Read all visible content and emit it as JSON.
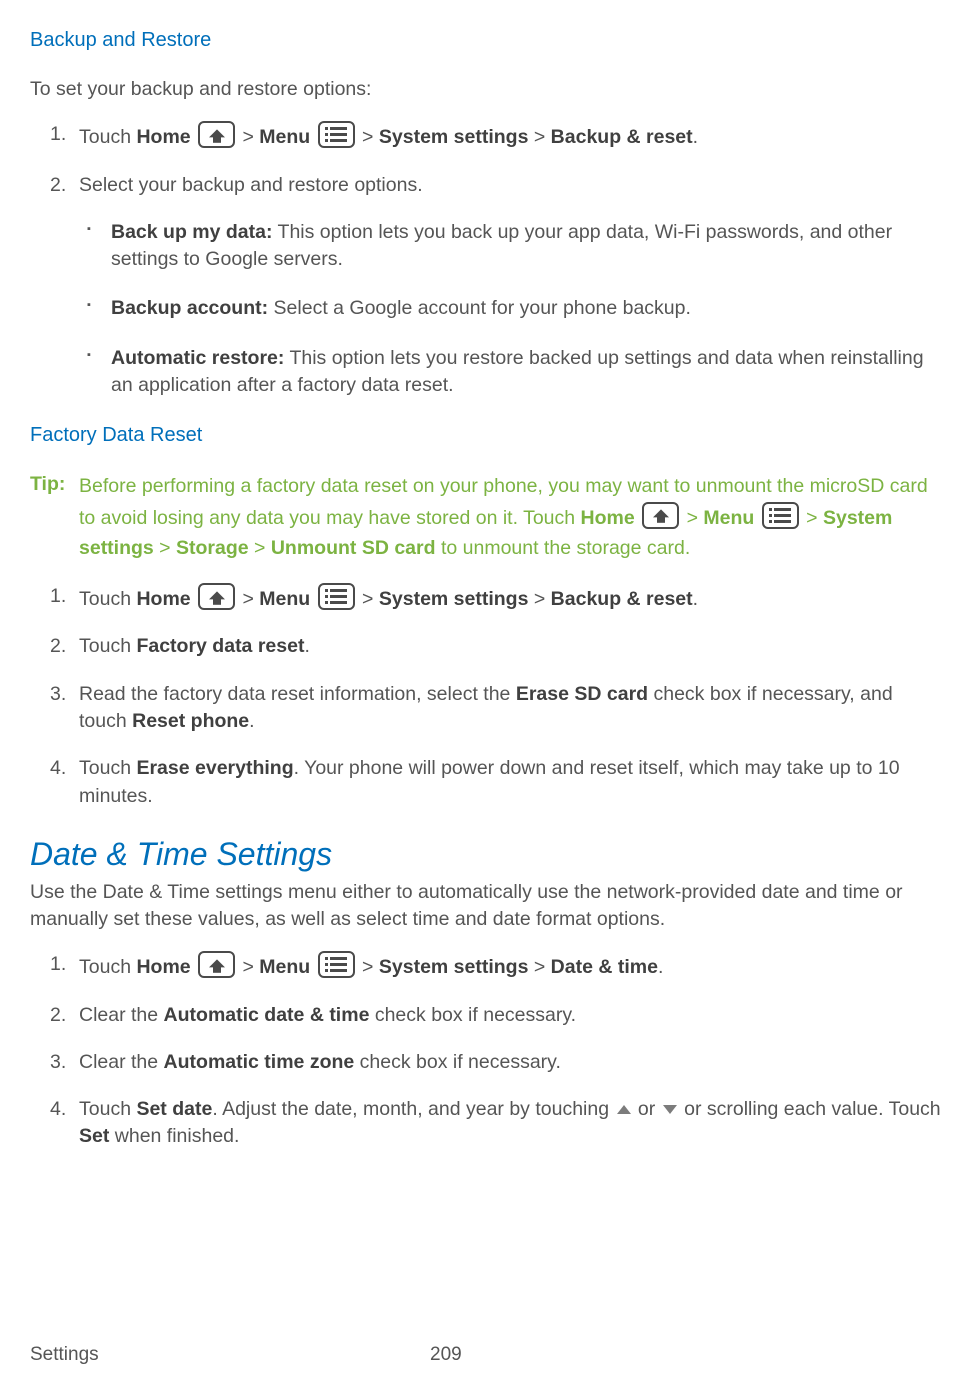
{
  "section1": {
    "title": "Backup and Restore",
    "intro": "To set your backup and restore options:",
    "step1_touch": "Touch ",
    "home_label": "Home",
    "gt": " > ",
    "menu_label": "Menu",
    "system_settings_label": "System settings",
    "backup_reset_label": "Backup & reset",
    "step1_end": ".",
    "step2": "Select your backup and restore options.",
    "bullet1_bold": "Back up my data:",
    "bullet1_text": " This option lets you back up your app data, Wi-Fi passwords, and other settings to Google servers.",
    "bullet2_bold": "Backup account:",
    "bullet2_text": " Select a Google account for your phone backup.",
    "bullet3_bold": "Automatic restore:",
    "bullet3_text": " This option lets you restore backed up settings and data when reinstalling an application after a factory data reset."
  },
  "section2": {
    "title": "Factory Data Reset",
    "tip_label": "Tip:",
    "tip_text1": "Before performing a factory data reset on your phone, you may want to unmount the microSD card to avoid losing any data you may have stored on it. Touch ",
    "home_label": "Home",
    "gt": " > ",
    "menu_label": "Menu",
    "system_settings_label": "System settings",
    "storage_label": "Storage",
    "unmount_label": "Unmount SD card",
    "tip_text2": " to unmount the storage card.",
    "step1_touch": "Touch ",
    "backup_reset_label": "Backup & reset",
    "step1_end": ".",
    "step2_pre": "Touch ",
    "step2_bold": "Factory data reset",
    "step2_post": ".",
    "step3_pre": "Read the factory data reset information, select the ",
    "step3_bold1": "Erase SD card",
    "step3_mid": " check box if necessary, and touch ",
    "step3_bold2": "Reset phone",
    "step3_post": ".",
    "step4_pre": "Touch ",
    "step4_bold": "Erase everything",
    "step4_post": ". Your phone will power down and reset itself, which may take up to 10 minutes."
  },
  "section3": {
    "title": "Date & Time Settings",
    "intro": "Use the Date & Time settings menu either to automatically use the network-provided date and time or manually set these values, as well as select time and date format options.",
    "step1_touch": "Touch ",
    "home_label": "Home",
    "gt": " > ",
    "menu_label": "Menu",
    "system_settings_label": "System settings",
    "date_time_label": "Date & time",
    "step1_end": ".",
    "step2_pre": "Clear the ",
    "step2_bold": "Automatic date & time",
    "step2_post": " check box if necessary.",
    "step3_pre": "Clear the ",
    "step3_bold": "Automatic time zone",
    "step3_post": " check box if necessary.",
    "step4_pre": "Touch ",
    "step4_bold1": "Set date",
    "step4_mid1": ". Adjust the date, month, and year by touching ",
    "step4_or": " or ",
    "step4_mid2": " or scrolling each value. Touch ",
    "step4_bold2": "Set",
    "step4_post": " when finished."
  },
  "footer": {
    "title": "Settings",
    "page": "209"
  }
}
